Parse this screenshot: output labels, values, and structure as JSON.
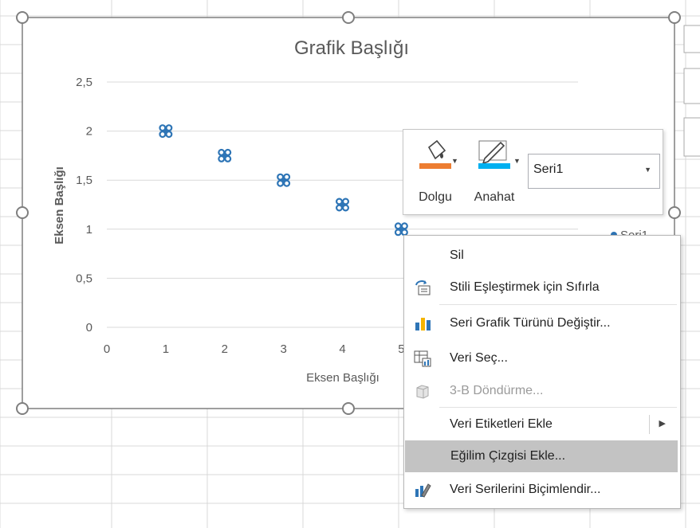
{
  "chart": {
    "title": "Grafik Başlığı",
    "y_axis_title": "Eksen Başlığı",
    "x_axis_title": "Eksen Başlığı",
    "legend_partial": "Seri1"
  },
  "chart_data": {
    "type": "scatter",
    "title": "Grafik Başlığı",
    "xlabel": "Eksen Başlığı",
    "ylabel": "Eksen Başlığı",
    "xlim": [
      0,
      5
    ],
    "ylim": [
      0,
      2.5
    ],
    "x_ticks": [
      "0",
      "1",
      "2",
      "3",
      "4",
      "5"
    ],
    "y_ticks": [
      "0",
      "0,5",
      "1",
      "1,5",
      "2",
      "2,5"
    ],
    "grid": true,
    "legend": "right",
    "series": [
      {
        "name": "Seri1",
        "color": "#2e75b6",
        "x": [
          1,
          2,
          3,
          4,
          5
        ],
        "y": [
          2,
          1.75,
          1.5,
          1.25,
          1
        ]
      }
    ]
  },
  "minibar": {
    "fill_label": "Dolgu",
    "outline_label": "Anahat",
    "series_value": "Seri1",
    "fill_color": "#ed7d31",
    "outline_color": "#00b0f0"
  },
  "context_menu": {
    "items": [
      {
        "label": "Sil",
        "icon": "none"
      },
      {
        "label": "Stili Eşleştirmek için Sıfırla",
        "icon": "reset-style-icon"
      },
      {
        "label": "Seri Grafik Türünü Değiştir...",
        "icon": "bar-chart-icon"
      },
      {
        "label": "Veri Seç...",
        "icon": "select-data-icon"
      },
      {
        "label": "3-B Döndürme...",
        "icon": "3d-rotate-icon",
        "disabled": true
      },
      {
        "label": "Veri Etiketleri Ekle",
        "icon": "none",
        "submenu": true
      },
      {
        "label": "Eğilim Çizgisi Ekle...",
        "icon": "none",
        "highlighted": true
      },
      {
        "label": "Veri Serilerini Biçimlendir...",
        "icon": "format-series-icon"
      }
    ]
  }
}
